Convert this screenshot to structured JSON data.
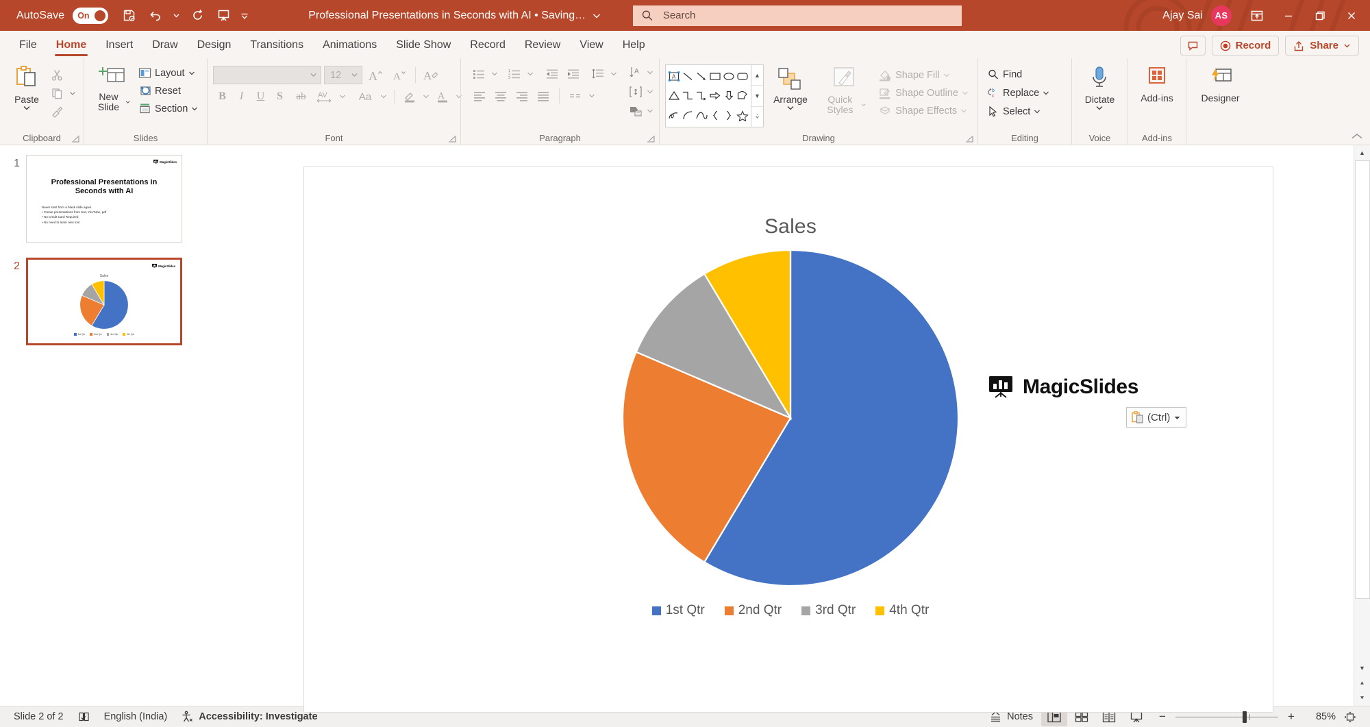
{
  "titlebar": {
    "autosave_label": "AutoSave",
    "autosave_state": "On",
    "save_icon": "save-icon",
    "undo_icon": "undo-icon",
    "redo_icon": "redo-icon",
    "present_icon": "start-presentation-icon",
    "customize_icon": "customize-quick-access-icon",
    "document_title": "Professional Presentations in Seconds with AI • Saving…",
    "title_chevron": "chevron-down-icon",
    "search_placeholder": "Search",
    "search_value": "",
    "search_icon": "search-icon",
    "user_name": "Ajay Sai",
    "avatar_initials": "AS",
    "ribbon_display_icon": "ribbon-display-options-icon",
    "minimize_icon": "minimize-icon",
    "restore_icon": "restore-icon",
    "close_icon": "close-icon",
    "bar_color": "#b7472a",
    "search_bg": "#f6cfc1"
  },
  "tabs": [
    {
      "label": "File",
      "active": false
    },
    {
      "label": "Home",
      "active": true
    },
    {
      "label": "Insert",
      "active": false
    },
    {
      "label": "Draw",
      "active": false
    },
    {
      "label": "Design",
      "active": false
    },
    {
      "label": "Transitions",
      "active": false
    },
    {
      "label": "Animations",
      "active": false
    },
    {
      "label": "Slide Show",
      "active": false
    },
    {
      "label": "Record",
      "active": false
    },
    {
      "label": "Review",
      "active": false
    },
    {
      "label": "View",
      "active": false
    },
    {
      "label": "Help",
      "active": false
    }
  ],
  "tabs_right": {
    "comments_icon": "comments-icon",
    "record_label": "Record",
    "share_label": "Share",
    "share_icon": "share-icon",
    "share_chevron": "chevron-down-icon"
  },
  "ribbon": {
    "clipboard": {
      "group_label": "Clipboard",
      "paste_label": "Paste",
      "cut_label": "Cut",
      "copy_label": "Copy",
      "format_painter_label": "Format Painter",
      "dialog_launcher": "dialog-launcher-icon"
    },
    "slides": {
      "group_label": "Slides",
      "new_slide_label": "New Slide",
      "layout_label": "Layout",
      "reset_label": "Reset",
      "section_label": "Section"
    },
    "font": {
      "group_label": "Font",
      "font_name_value": "",
      "font_size_value": "12",
      "increase_size_label": "A",
      "decrease_size_label": "A",
      "clear_formatting_label": "Clear All Formatting",
      "bold_label": "B",
      "italic_label": "I",
      "underline_label": "U",
      "shadow_label": "S",
      "strikethrough_label": "ab",
      "char_spacing_label": "AV",
      "change_case_label": "Aa",
      "highlight_label": "Text Highlight Color",
      "font_color_label": "A",
      "disabled": true
    },
    "paragraph": {
      "group_label": "Paragraph",
      "bullets_label": "Bullets",
      "numbering_label": "Numbering",
      "decrease_indent_label": "Decrease List Level",
      "increase_indent_label": "Increase List Level",
      "line_spacing_label": "Line Spacing",
      "text_direction_label": "Text Direction",
      "align_text_label": "Align Text",
      "smartart_label": "Convert to SmartArt",
      "align_left_label": "Align Left",
      "align_center_label": "Center",
      "align_right_label": "Align Right",
      "justify_label": "Justify",
      "columns_label": "Columns"
    },
    "drawing": {
      "group_label": "Drawing",
      "arrange_label": "Arrange",
      "quick_styles_label": "Quick Styles",
      "shape_fill_label": "Shape Fill",
      "shape_outline_label": "Shape Outline",
      "shape_effects_label": "Shape Effects",
      "shapes_disabled": true
    },
    "editing": {
      "group_label": "Editing",
      "find_label": "Find",
      "replace_label": "Replace",
      "select_label": "Select"
    },
    "voice": {
      "group_label": "Voice",
      "dictate_label": "Dictate"
    },
    "addins": {
      "group_label": "Add-ins",
      "addins_label": "Add-ins"
    },
    "designer": {
      "designer_label": "Designer"
    },
    "collapse_icon": "collapse-ribbon-icon"
  },
  "thumbnails": [
    {
      "number": "1",
      "selected": false,
      "title": "Professional Presentations in Seconds with AI",
      "bullets": [
        "Never start from a blank slide again.",
        "• Create presentations from text, YouTube, pdf",
        "• No Credit Card Required",
        "• No need to learn new tool"
      ],
      "brand": "MagicSlides"
    },
    {
      "number": "2",
      "selected": true,
      "chart_title": "Sales",
      "brand": "MagicSlides"
    }
  ],
  "slide": {
    "brand_name": "MagicSlides",
    "paste_options_label": "(Ctrl)",
    "paste_options_icon": "paste-options-icon",
    "paste_chevron": "chevron-down-icon"
  },
  "chart_data": {
    "type": "pie",
    "title": "Sales",
    "categories": [
      "1st Qtr",
      "2nd Qtr",
      "3rd Qtr",
      "4th Qtr"
    ],
    "values": [
      8.2,
      3.2,
      1.4,
      1.2
    ],
    "colors": [
      "#4472c4",
      "#ed7d31",
      "#a5a5a5",
      "#ffc000"
    ],
    "legend_position": "bottom",
    "grid": false,
    "start_angle": 0,
    "title_color": "#595959",
    "legend_text_color": "#595959"
  },
  "status": {
    "slide_indicator": "Slide 2 of 2",
    "spellcheck_icon": "spellcheck-icon",
    "language": "English (India)",
    "accessibility_icon": "accessibility-icon",
    "accessibility_label": "Accessibility: Investigate",
    "notes_label": "Notes",
    "notes_icon": "notes-icon",
    "view_normal": "Normal View",
    "view_sorter": "Slide Sorter",
    "view_reading": "Reading View",
    "view_slideshow": "Slide Show",
    "zoom_out_label": "−",
    "zoom_in_label": "+",
    "zoom_level": "85%",
    "fit_icon": "fit-slide-to-window-icon"
  }
}
